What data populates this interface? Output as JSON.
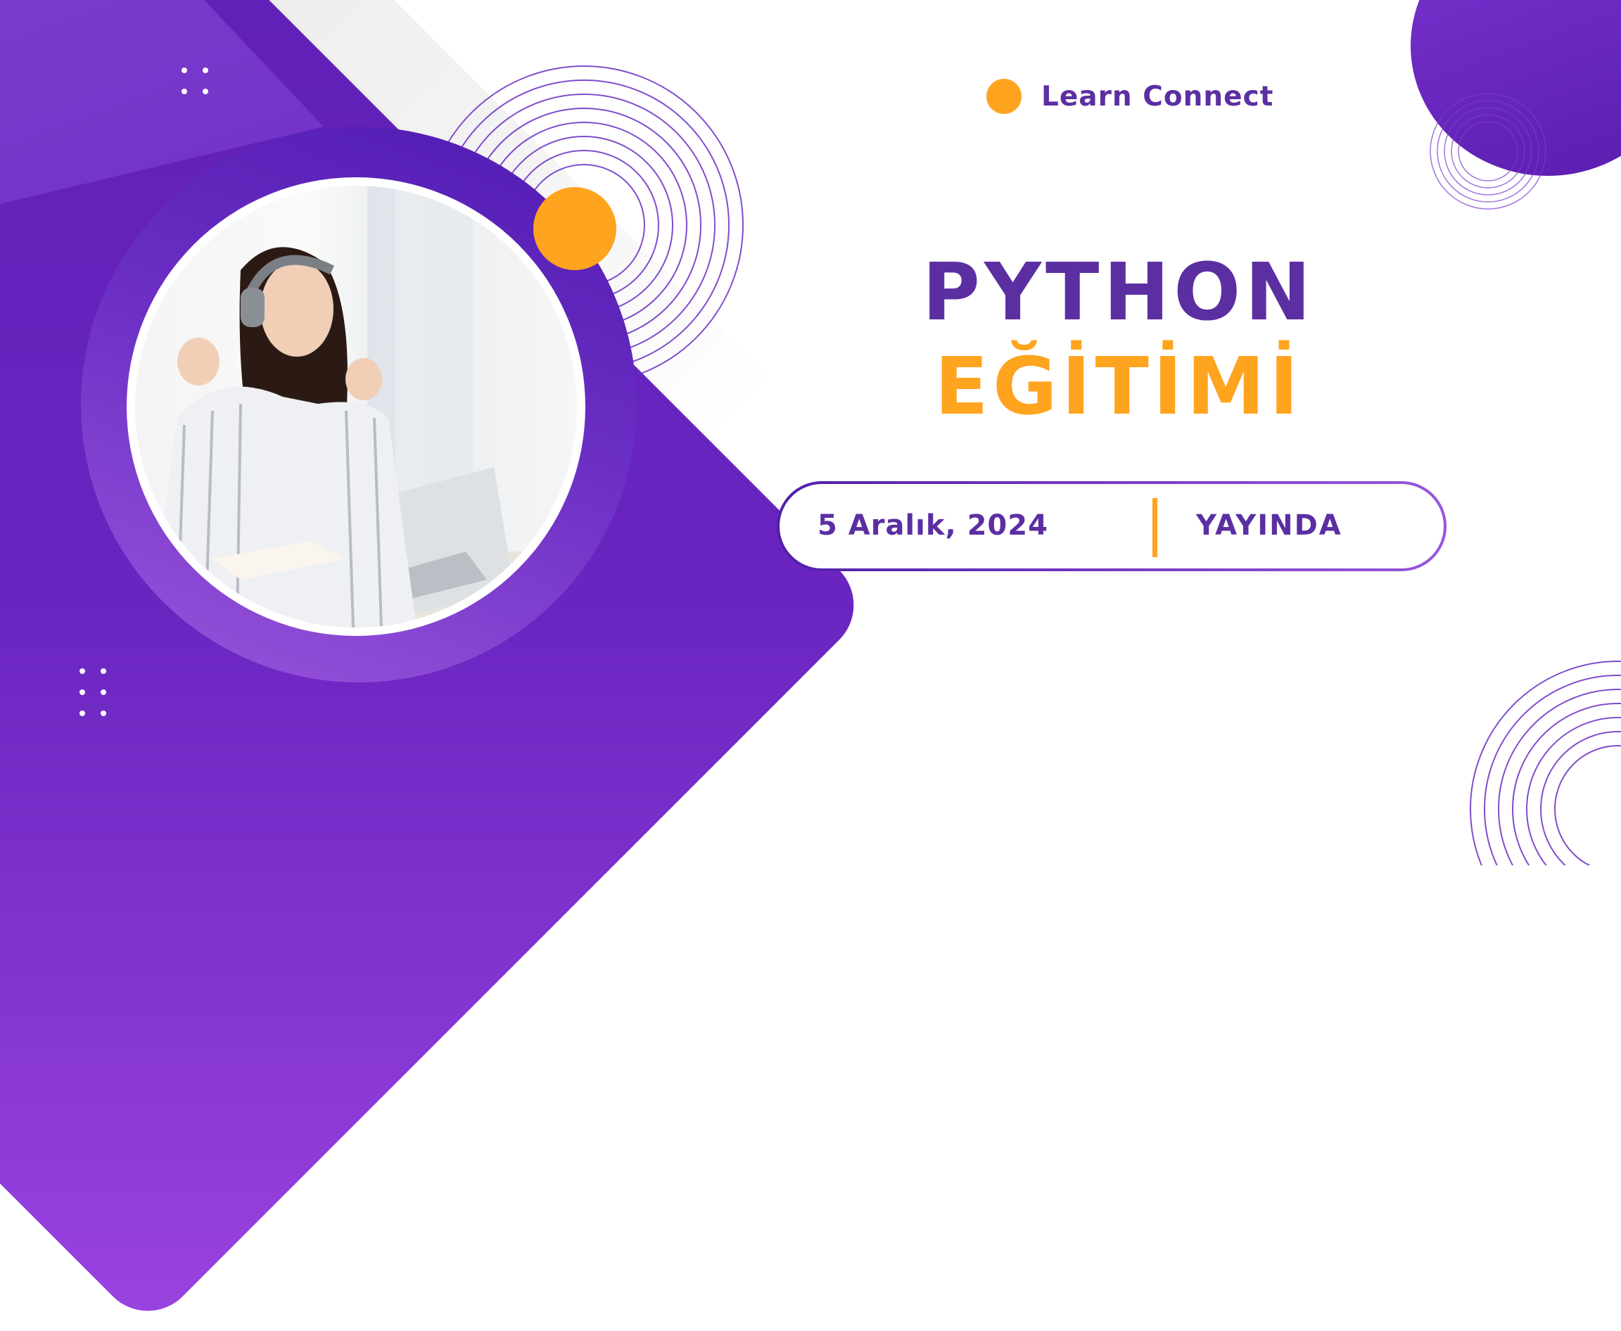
{
  "brand": {
    "name": "Learn Connect"
  },
  "headline": {
    "line1": "PYTHON",
    "line2": "EĞİTİMİ"
  },
  "event": {
    "date": "5 Aralık, 2024",
    "status": "YAYINDA"
  },
  "icons": {
    "photo": "person-with-headphones-at-laptop-photo",
    "brand_mark": "orange-dot-icon"
  },
  "colors": {
    "purple": "#5b2fa2",
    "orange": "#ffa41f",
    "deep_purple": "#5f1fb6",
    "light_purple": "#9a55dc",
    "background": "#ffffff"
  }
}
